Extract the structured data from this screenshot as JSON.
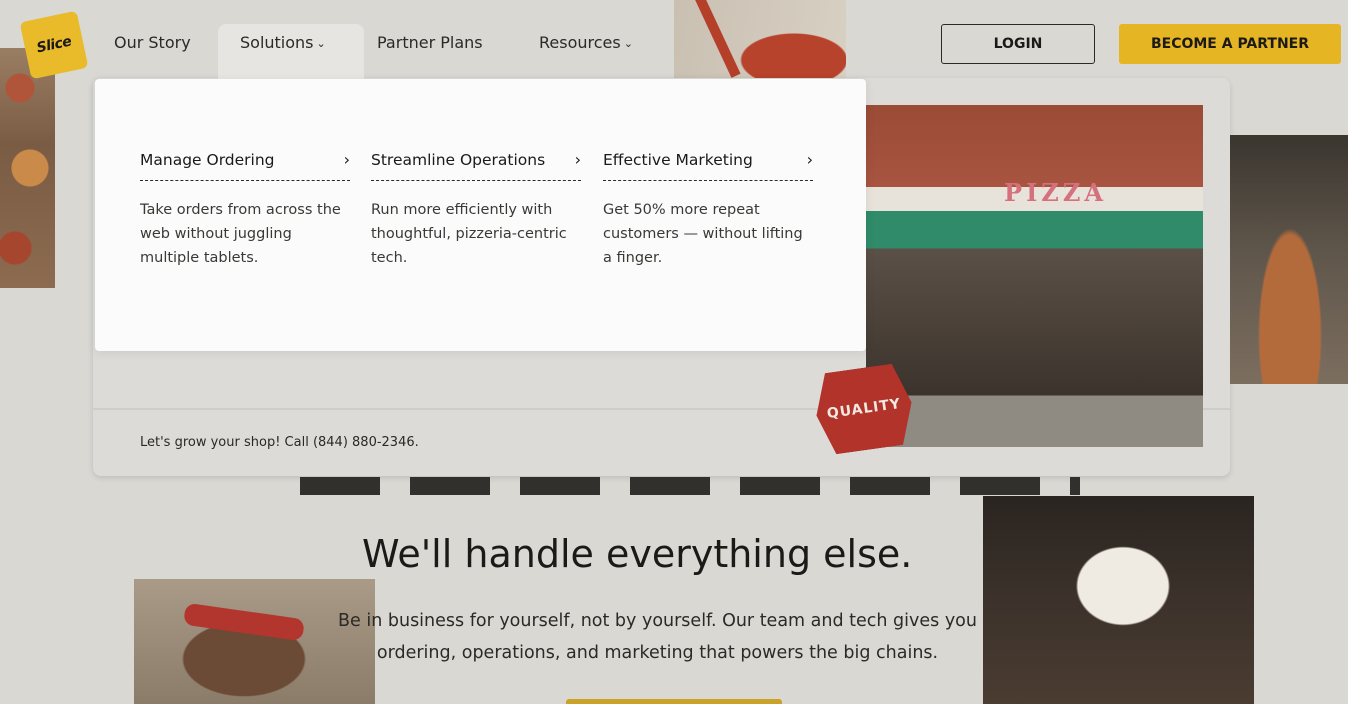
{
  "nav": {
    "logo_text": "Slice",
    "items": [
      {
        "label": "Our Story",
        "has_dropdown": false
      },
      {
        "label": "Solutions",
        "has_dropdown": true
      },
      {
        "label": "Partner Plans",
        "has_dropdown": false
      },
      {
        "label": "Resources",
        "has_dropdown": true
      }
    ],
    "login_label": "LOGIN",
    "partner_label": "BECOME A PARTNER"
  },
  "colors": {
    "accent_yellow": "#e5b523",
    "badge_red": "#b1332a",
    "background": "#d9d8d3"
  },
  "solutions_menu": {
    "columns": [
      {
        "title": "Manage Ordering",
        "description": "Take orders from across the web without juggling multiple tablets."
      },
      {
        "title": "Streamline Operations",
        "description": "Run more efficiently with thoughtful, pizzeria-centric tech."
      },
      {
        "title": "Effective Marketing",
        "description": "Get 50% more repeat customers — without lifting a finger."
      }
    ],
    "arrow_icon": "chevron-right-icon"
  },
  "hero": {
    "contact_text": "Let's grow your shop! Call (844) 880-2346.",
    "storefront_sign": "PIZZA",
    "badge_text": "QUALITY",
    "headline": "We'll handle everything else.",
    "subcopy": "Be in business for yourself, not by yourself. Our team and tech gives you ordering, operations, and marketing that powers the big chains."
  }
}
